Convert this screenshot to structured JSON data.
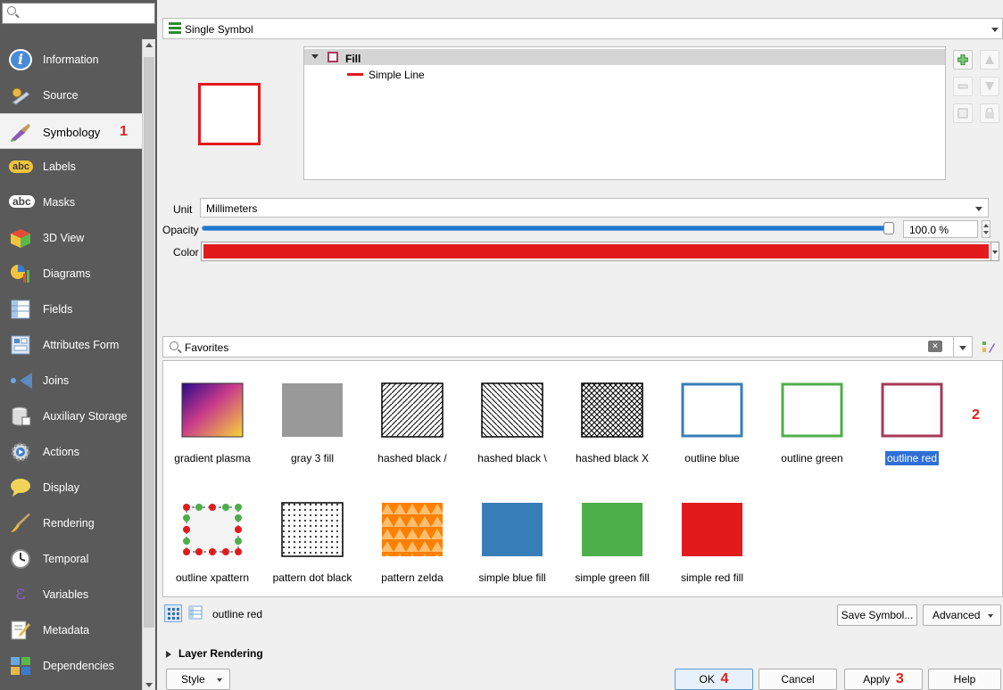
{
  "sidebar": {
    "search_placeholder": "",
    "items": [
      {
        "label": "Information",
        "icon": "info-icon"
      },
      {
        "label": "Source",
        "icon": "source-icon"
      },
      {
        "label": "Symbology",
        "icon": "paintbrush-icon",
        "active": true,
        "annotation": "1"
      },
      {
        "label": "Labels",
        "icon": "labels-icon"
      },
      {
        "label": "Masks",
        "icon": "masks-icon"
      },
      {
        "label": "3D View",
        "icon": "cube-icon"
      },
      {
        "label": "Diagrams",
        "icon": "diagram-icon"
      },
      {
        "label": "Fields",
        "icon": "fields-icon"
      },
      {
        "label": "Attributes Form",
        "icon": "form-icon"
      },
      {
        "label": "Joins",
        "icon": "joins-icon"
      },
      {
        "label": "Auxiliary Storage",
        "icon": "storage-icon"
      },
      {
        "label": "Actions",
        "icon": "actions-icon"
      },
      {
        "label": "Display",
        "icon": "speech-bubble-icon"
      },
      {
        "label": "Rendering",
        "icon": "brush-icon"
      },
      {
        "label": "Temporal",
        "icon": "clock-icon"
      },
      {
        "label": "Variables",
        "icon": "epsilon-icon"
      },
      {
        "label": "Metadata",
        "icon": "metadata-icon"
      },
      {
        "label": "Dependencies",
        "icon": "dependencies-icon"
      }
    ]
  },
  "renderer": {
    "label": "Single Symbol"
  },
  "symbol_tree": {
    "fill_label": "Fill",
    "line_label": "Simple Line"
  },
  "properties": {
    "unit_label": "Unit",
    "unit_value": "Millimeters",
    "opacity_label": "Opacity",
    "opacity_value": "100.0 %",
    "opacity_fraction": 1.0,
    "color_label": "Color",
    "color_value": "#e31a1c"
  },
  "favorites": {
    "search_value": "Favorites"
  },
  "gallery": {
    "annotation": "2",
    "symbols": [
      {
        "name": "gradient plasma"
      },
      {
        "name": "gray 3 fill"
      },
      {
        "name": "hashed black /"
      },
      {
        "name": "hashed black \\"
      },
      {
        "name": "hashed black X"
      },
      {
        "name": "outline blue"
      },
      {
        "name": "outline green"
      },
      {
        "name": "outline red",
        "selected": true
      },
      {
        "name": "outline xpattern"
      },
      {
        "name": "pattern dot black"
      },
      {
        "name": "pattern zelda"
      },
      {
        "name": "simple blue fill"
      },
      {
        "name": "simple green fill"
      },
      {
        "name": "simple red fill"
      }
    ]
  },
  "bottom_bar": {
    "selected_name": "outline red",
    "save_symbol": "Save Symbol...",
    "advanced": "Advanced"
  },
  "layer_rendering": {
    "label": "Layer Rendering"
  },
  "footer": {
    "style": "Style",
    "ok": "OK",
    "ok_annotation": "4",
    "cancel": "Cancel",
    "apply": "Apply",
    "apply_annotation": "3",
    "help": "Help"
  },
  "colors": {
    "accent": "#e31a1c",
    "selection": "#2f6fd6",
    "sidebar_bg": "#5a5a5a",
    "annotation": "#e0201c"
  }
}
